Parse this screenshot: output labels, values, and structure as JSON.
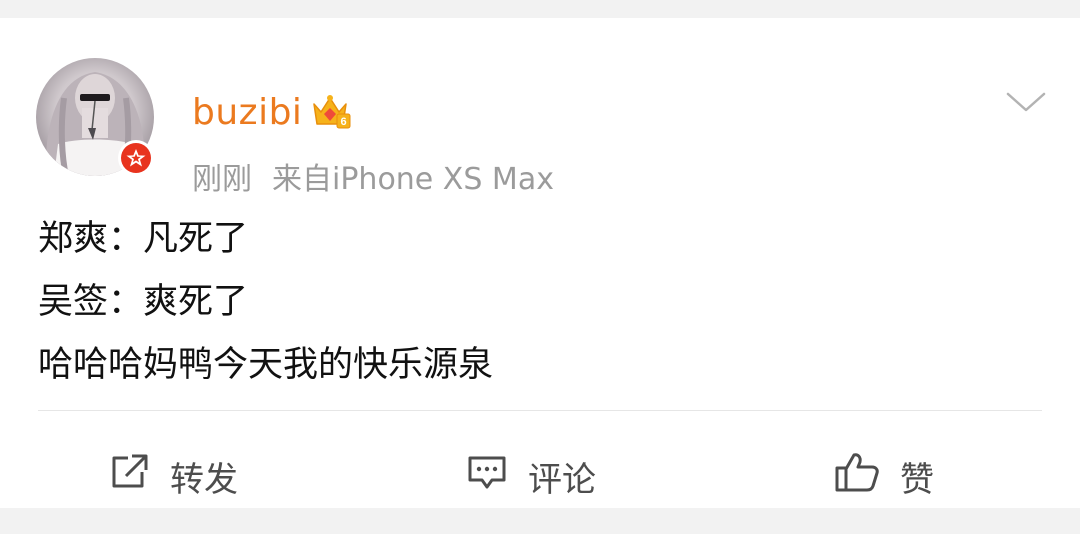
{
  "post": {
    "username": "buzibi",
    "time": "刚刚",
    "source": "来自iPhone XS Max",
    "content_lines": [
      "郑爽：凡死了",
      "吴签：爽死了",
      "哈哈哈妈鸭今天我的快乐源泉"
    ]
  },
  "actions": {
    "repost_label": "转发",
    "comment_label": "评论",
    "like_label": "赞"
  },
  "icons": {
    "avatar": "avatar",
    "vip_badge": "verified-badge-icon",
    "crown": "crown-icon",
    "chevron": "chevron-down-icon",
    "repost": "repost-icon",
    "comment": "comment-icon",
    "like": "thumbs-up-icon"
  },
  "colors": {
    "username": "#eb7a1f",
    "meta": "#9b9b9b",
    "badge_red": "#e8331e",
    "text": "#111111"
  }
}
